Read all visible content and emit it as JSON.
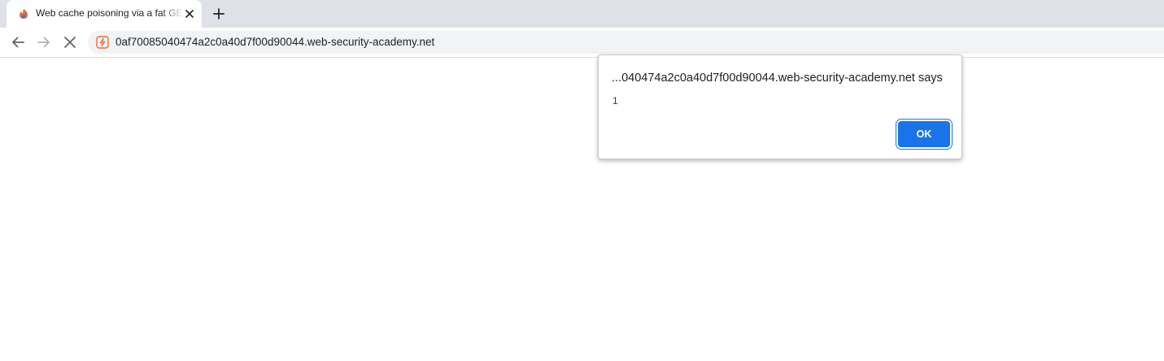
{
  "tab": {
    "title": "Web cache poisoning via a fat GET request",
    "favicon": "web-security-academy-favicon",
    "close_icon": "close-icon"
  },
  "toolbar": {
    "back_icon": "back-arrow-icon",
    "forward_icon": "forward-arrow-icon",
    "stop_icon": "stop-loading-icon",
    "new_tab_icon": "plus-icon",
    "url": "0af70085040474a2c0a40d7f00d90044.web-security-academy.net"
  },
  "dialog": {
    "title": "...040474a2c0a40d7f00d90044.web-security-academy.net says",
    "message": "1",
    "ok_label": "OK"
  },
  "colors": {
    "tabstrip_bg": "#dee1e6",
    "omnibox_bg": "#f1f3f4",
    "accent_blue": "#1a73e8",
    "favicon_orange": "#f06935"
  }
}
